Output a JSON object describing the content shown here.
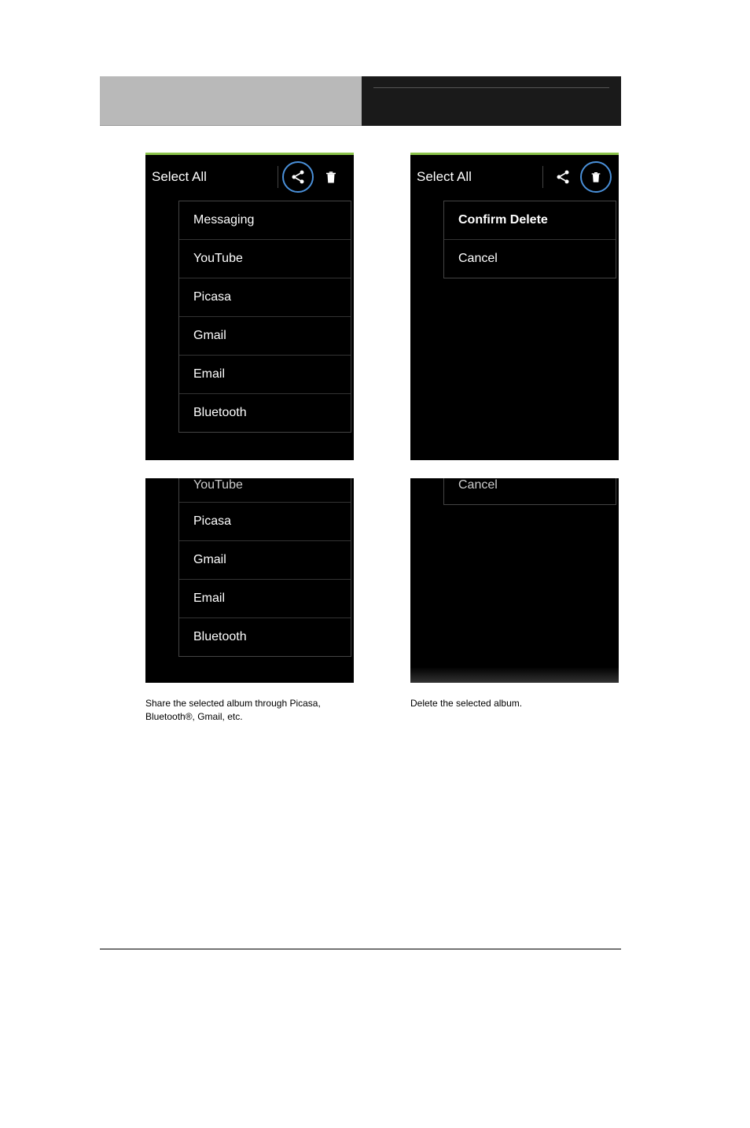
{
  "toolbar": {
    "select_all": "Select All"
  },
  "share_menu": {
    "items": [
      "Messaging",
      "YouTube",
      "Picasa",
      "Gmail",
      "Email",
      "Bluetooth"
    ]
  },
  "share_menu_partial": {
    "top": "YouTube",
    "items": [
      "Picasa",
      "Gmail",
      "Email",
      "Bluetooth"
    ]
  },
  "delete_menu": {
    "confirm": "Confirm Delete",
    "cancel": "Cancel"
  },
  "delete_partial": {
    "cancel": "Cancel"
  },
  "captions": {
    "share": "Share the selected album through Picasa, Bluetooth®, Gmail, etc.",
    "delete": "Delete the selected album."
  }
}
